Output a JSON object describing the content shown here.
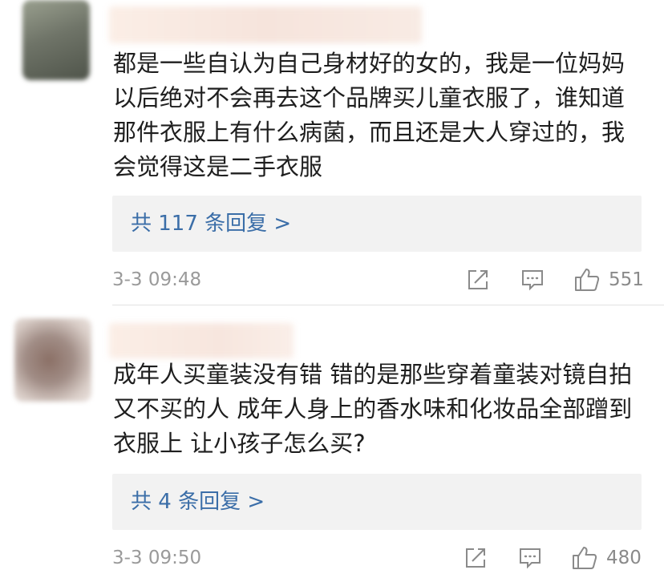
{
  "colors": {
    "link": "#3b6ea8",
    "meta": "#9a9a9a",
    "reply_box": "#f2f2f2",
    "divider": "#e3e3e3"
  },
  "comments": [
    {
      "text": "都是一些自认为自己身材好的女的，我是一位妈妈以后绝对不会再去这个品牌买儿童衣服了，谁知道那件衣服上有什么病菌，而且还是大人穿过的，我会觉得这是二手衣服",
      "replies_label": "共 117 条回复 >",
      "timestamp": "3-3 09:48",
      "likes": "551",
      "icons": [
        "share-icon",
        "comment-icon",
        "like-icon"
      ]
    },
    {
      "text": "成年人买童装没有错 错的是那些穿着童装对镜自拍又不买的人 成年人身上的香水味和化妆品全部蹭到衣服上 让小孩子怎么买?",
      "replies_label": "共 4 条回复 >",
      "timestamp": "3-3 09:50",
      "likes": "480",
      "icons": [
        "share-icon",
        "comment-icon",
        "like-icon"
      ]
    }
  ]
}
